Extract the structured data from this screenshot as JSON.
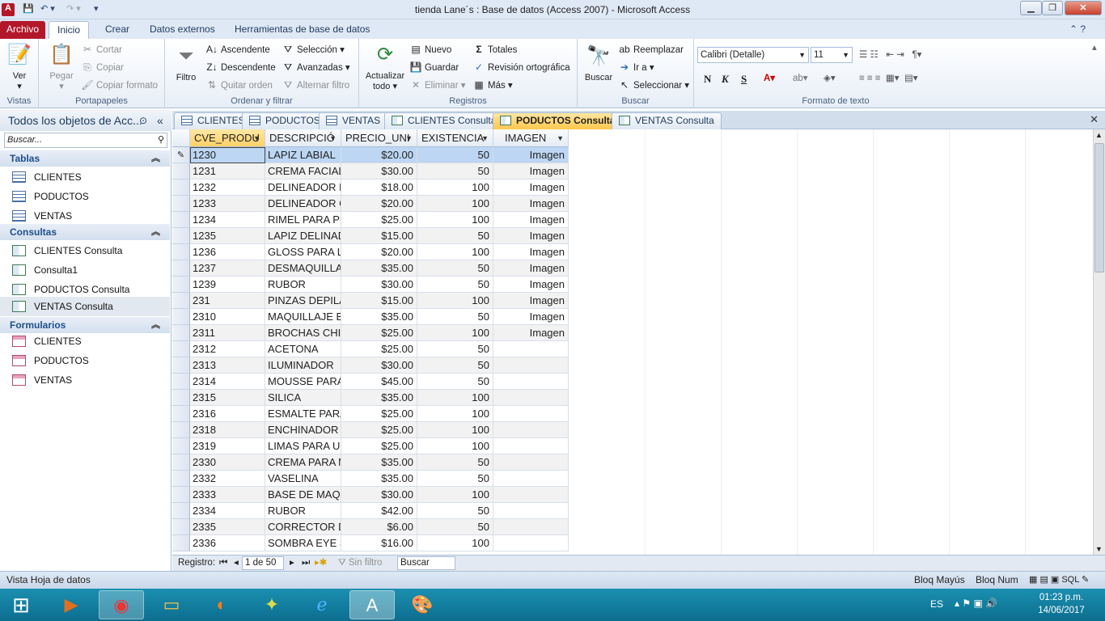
{
  "window": {
    "title": "tienda Lane´s : Base de datos (Access 2007)  -  Microsoft Access",
    "app_icon": "A"
  },
  "ribbon_tabs": [
    "Archivo",
    "Inicio",
    "Crear",
    "Datos externos",
    "Herramientas de base de datos"
  ],
  "ribbon": {
    "vistas": {
      "label": "Vistas",
      "ver": "Ver"
    },
    "portapapeles": {
      "label": "Portapapeles",
      "pegar": "Pegar",
      "cortar": "Cortar",
      "copiar": "Copiar",
      "copiar_formato": "Copiar formato"
    },
    "ordenar": {
      "label": "Ordenar y filtrar",
      "filtro": "Filtro",
      "ascendente": "Ascendente",
      "descendente": "Descendente",
      "quitar_orden": "Quitar orden",
      "seleccion": "Selección",
      "avanzadas": "Avanzadas",
      "alternar_filtro": "Alternar filtro"
    },
    "registros": {
      "label": "Registros",
      "actualizar_line1": "Actualizar",
      "actualizar_line2": "todo",
      "nuevo": "Nuevo",
      "guardar": "Guardar",
      "eliminar": "Eliminar",
      "totales": "Totales",
      "revision": "Revisión ortográfica",
      "mas": "Más"
    },
    "buscar": {
      "label": "Buscar",
      "buscar": "Buscar",
      "reemplazar": "Reemplazar",
      "ir_a": "Ir a",
      "seleccionar": "Seleccionar"
    },
    "formato": {
      "label": "Formato de texto",
      "font": "Calibri (Detalle)",
      "size": "11",
      "bold": "N",
      "italic": "K",
      "underline": "S"
    }
  },
  "nav": {
    "header": "Todos los objetos de Acc...",
    "search_placeholder": "Buscar...",
    "sections": [
      {
        "title": "Tablas",
        "items": [
          "CLIENTES",
          "PODUCTOS",
          "VENTAS"
        ]
      },
      {
        "title": "Consultas",
        "items": [
          "CLIENTES Consulta",
          "Consulta1",
          "PODUCTOS Consulta",
          "VENTAS Consulta"
        ]
      },
      {
        "title": "Formularios",
        "items": [
          "CLIENTES",
          "PODUCTOS",
          "VENTAS"
        ]
      }
    ]
  },
  "doc_tabs": [
    "CLIENTES",
    "PODUCTOS",
    "VENTAS",
    "CLIENTES Consulta",
    "PODUCTOS Consulta",
    "VENTAS Consulta"
  ],
  "grid": {
    "columns": [
      "CVE_PRODU",
      "DESCRIPCIÓ",
      "PRECIO_UNI",
      "EXISTENCIA",
      "IMAGEN"
    ],
    "rows": [
      [
        "1230",
        "LAPIZ LABIAL",
        "$20.00",
        "50",
        "Imagen"
      ],
      [
        "1231",
        "CREMA FACIAL",
        "$30.00",
        "50",
        "Imagen"
      ],
      [
        "1232",
        "DELINEADOR L",
        "$18.00",
        "100",
        "Imagen"
      ],
      [
        "1233",
        "DELINEADOR G",
        "$20.00",
        "100",
        "Imagen"
      ],
      [
        "1234",
        "RIMEL PARA PE",
        "$25.00",
        "100",
        "Imagen"
      ],
      [
        "1235",
        "LAPIZ DELINAD",
        "$15.00",
        "50",
        "Imagen"
      ],
      [
        "1236",
        "GLOSS PARA LA",
        "$20.00",
        "100",
        "Imagen"
      ],
      [
        "1237",
        "DESMAQUILLA",
        "$35.00",
        "50",
        "Imagen"
      ],
      [
        "1239",
        "RUBOR",
        "$30.00",
        "50",
        "Imagen"
      ],
      [
        "231",
        "PINZAS DEPILA",
        "$15.00",
        "100",
        "Imagen"
      ],
      [
        "2310",
        "MAQUILLAJE B.",
        "$35.00",
        "50",
        "Imagen"
      ],
      [
        "2311",
        "BROCHAS CHIC",
        "$25.00",
        "100",
        "Imagen"
      ],
      [
        "2312",
        "ACETONA",
        "$25.00",
        "50",
        ""
      ],
      [
        "2313",
        "ILUMINADOR",
        "$30.00",
        "50",
        ""
      ],
      [
        "2314",
        "MOUSSE PARA",
        "$45.00",
        "50",
        ""
      ],
      [
        "2315",
        "SILICA",
        "$35.00",
        "100",
        ""
      ],
      [
        "2316",
        "ESMALTE PARA",
        "$25.00",
        "100",
        ""
      ],
      [
        "2318",
        "ENCHINADOR",
        "$25.00",
        "100",
        ""
      ],
      [
        "2319",
        "LIMAS PARA UI",
        "$25.00",
        "100",
        ""
      ],
      [
        "2330",
        "CREMA PARA M",
        "$35.00",
        "50",
        ""
      ],
      [
        "2332",
        "VASELINA",
        "$35.00",
        "50",
        ""
      ],
      [
        "2333",
        "BASE DE MAQU",
        "$30.00",
        "100",
        ""
      ],
      [
        "2334",
        "RUBOR",
        "$42.00",
        "50",
        ""
      ],
      [
        "2335",
        "CORRECTOR DI",
        "$6.00",
        "50",
        ""
      ],
      [
        "2336",
        "SOMBRA EYE S",
        "$16.00",
        "100",
        ""
      ]
    ]
  },
  "recnav": {
    "label": "Registro:",
    "position": "1 de 50",
    "filter": "Sin filtro",
    "search": "Buscar"
  },
  "status": {
    "left": "Vista Hoja de datos",
    "caps": "Bloq Mayús",
    "num": "Bloq Num"
  },
  "taskbar": {
    "lang": "ES",
    "time": "01:23 p.m.",
    "date": "14/06/2017"
  }
}
